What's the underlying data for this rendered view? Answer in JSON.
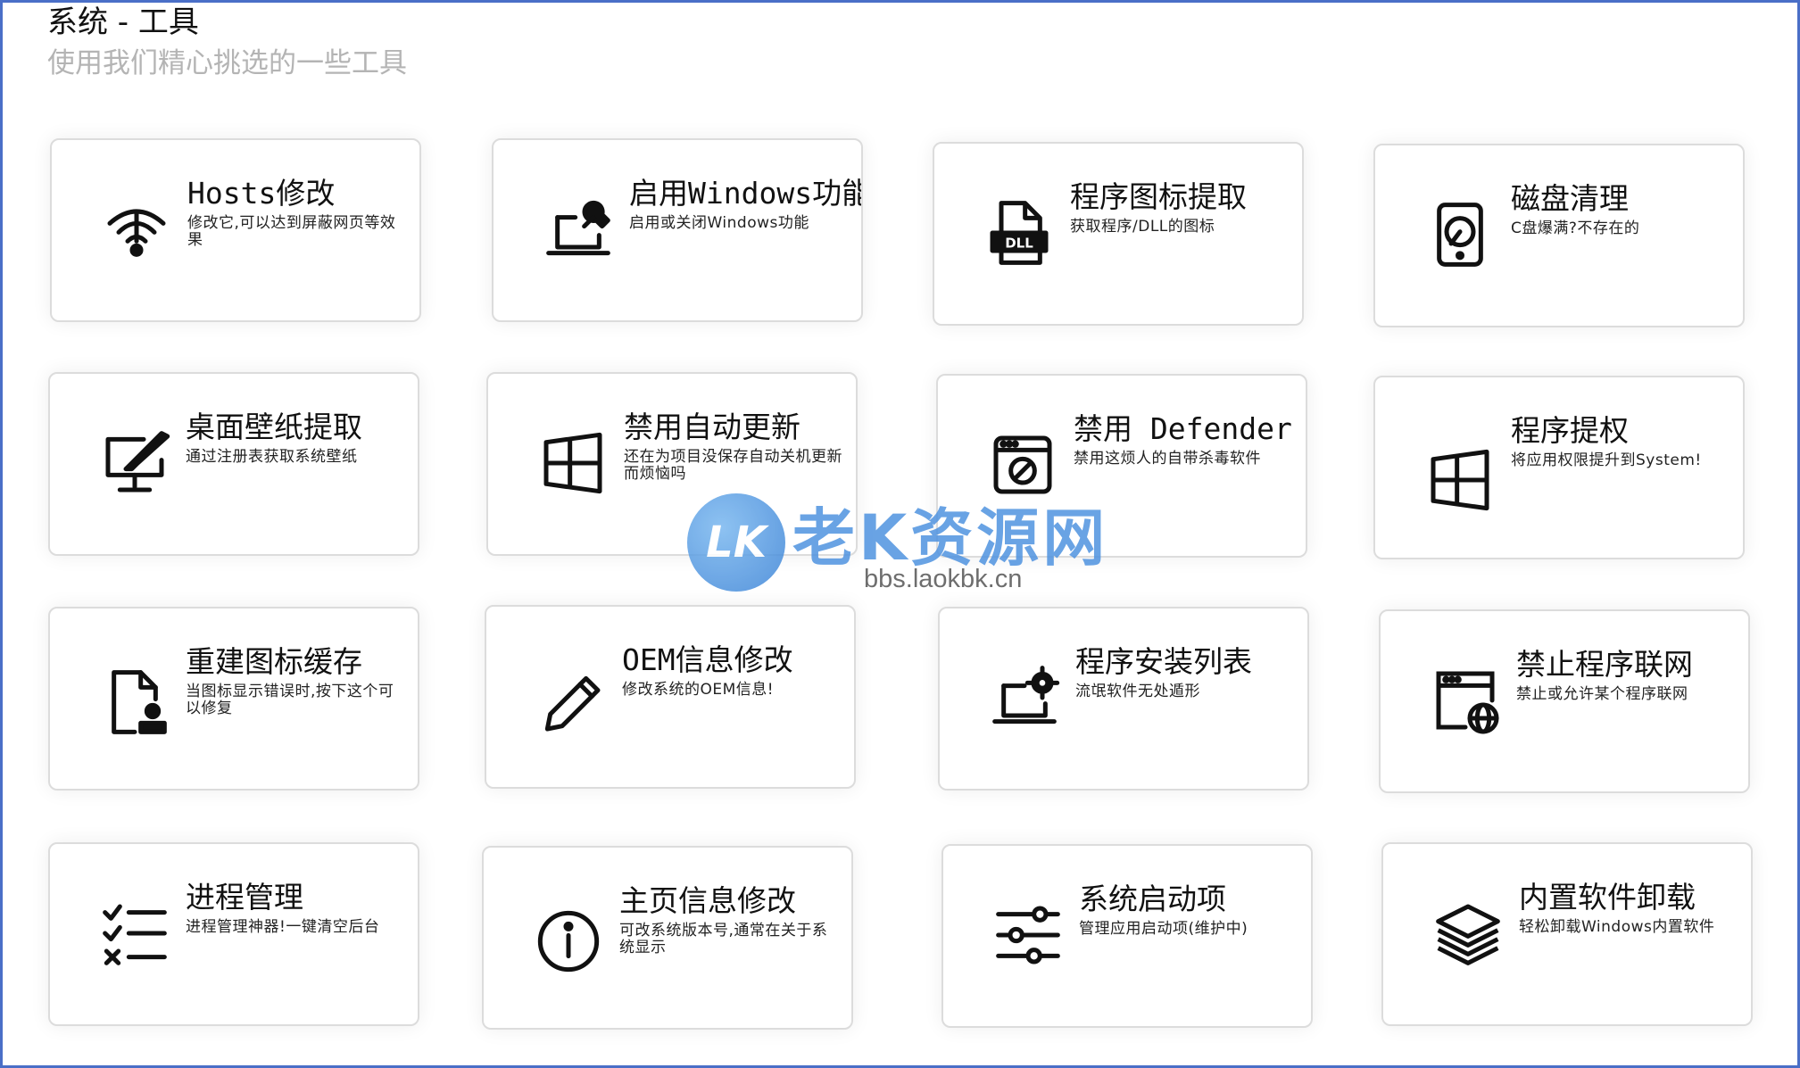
{
  "header": {
    "title": "系统 - 工具",
    "subtitle": "使用我们精心挑选的一些工具"
  },
  "tools": [
    {
      "icon": "wifi-icon",
      "title": "Hosts修改",
      "desc": "修改它,可以达到屏蔽网页等效果"
    },
    {
      "icon": "laptop-wrench-icon",
      "title": "启用Windows功能",
      "desc": "启用或关闭Windows功能"
    },
    {
      "icon": "dll-file-icon",
      "title": "程序图标提取",
      "desc": "获取程序/DLL的图标"
    },
    {
      "icon": "hard-disk-icon",
      "title": "磁盘清理",
      "desc": "C盘爆满?不存在的"
    },
    {
      "icon": "monitor-brush-icon",
      "title": "桌面壁纸提取",
      "desc": "通过注册表获取系统壁纸"
    },
    {
      "icon": "windows-logo-icon",
      "title": "禁用自动更新",
      "desc": "还在为项目没保存自动关机更新而烦恼吗"
    },
    {
      "icon": "window-block-icon",
      "title": "禁用 Defender",
      "desc": "禁用这烦人的自带杀毒软件"
    },
    {
      "icon": "windows-logo-icon",
      "title": "程序提权",
      "desc": "将应用权限提升到System!"
    },
    {
      "icon": "file-user-icon",
      "title": "重建图标缓存",
      "desc": "当图标显示错误时,按下这个可以修复"
    },
    {
      "icon": "pencil-icon",
      "title": "OEM信息修改",
      "desc": "修改系统的OEM信息!"
    },
    {
      "icon": "laptop-gear-icon",
      "title": "程序安装列表",
      "desc": "流氓软件无处遁形"
    },
    {
      "icon": "window-globe-icon",
      "title": "禁止程序联网",
      "desc": "禁止或允许某个程序联网"
    },
    {
      "icon": "checklist-icon",
      "title": "进程管理",
      "desc": "进程管理神器!一键清空后台"
    },
    {
      "icon": "info-icon",
      "title": "主页信息修改",
      "desc": "可改系统版本号,通常在关于系统显示"
    },
    {
      "icon": "sliders-icon",
      "title": "系统启动项",
      "desc": "管理应用启动项(维护中)"
    },
    {
      "icon": "layers-icon",
      "title": "内置软件卸载",
      "desc": "轻松卸载Windows内置软件"
    }
  ],
  "watermark": {
    "logo": "LK",
    "name": "老K资源网",
    "url": "bbs.laokbk.cn"
  }
}
